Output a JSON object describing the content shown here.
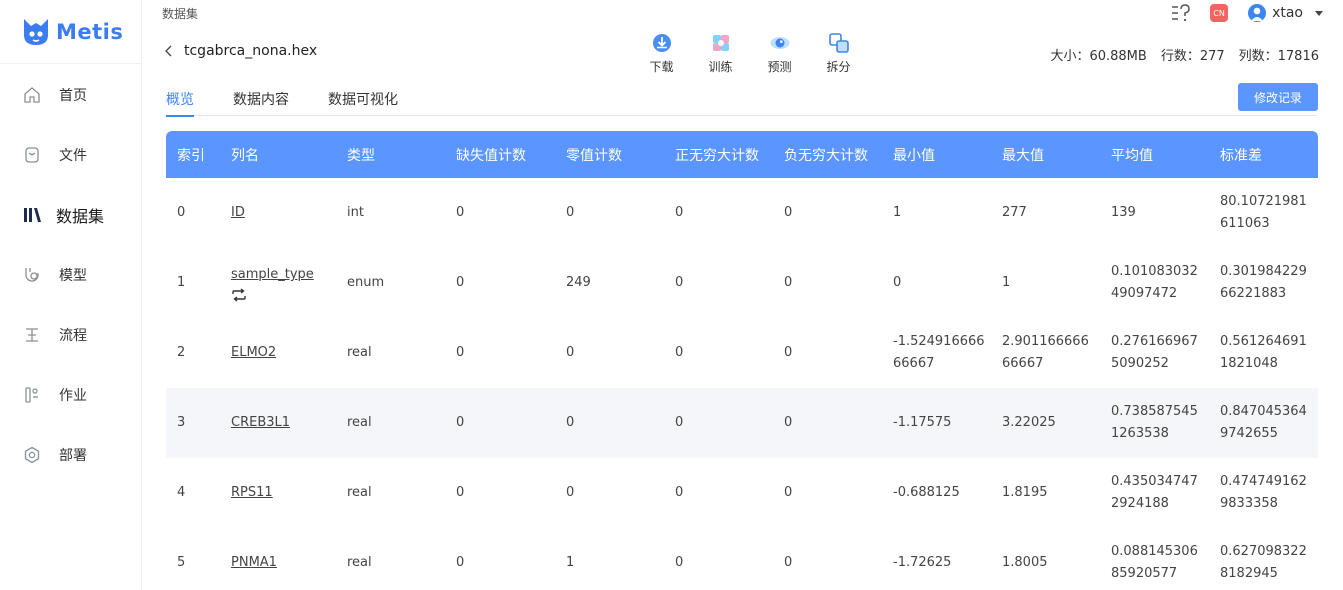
{
  "brand": {
    "name": "Metis",
    "color": "#3b7cf0"
  },
  "sidebar": {
    "items": [
      {
        "label": "首页",
        "icon": "home-icon"
      },
      {
        "label": "文件",
        "icon": "file-icon"
      },
      {
        "label": "数据集",
        "icon": "dataset-icon",
        "active": true
      },
      {
        "label": "模型",
        "icon": "model-icon"
      },
      {
        "label": "流程",
        "icon": "flow-icon"
      },
      {
        "label": "作业",
        "icon": "job-icon"
      },
      {
        "label": "部署",
        "icon": "deploy-icon"
      }
    ]
  },
  "header": {
    "breadcrumb": "数据集",
    "file_name": "tcgabrca_nona.hex",
    "lang_badge": "CN",
    "user": "xtao",
    "actions": [
      {
        "label": "下载",
        "icon": "download-icon"
      },
      {
        "label": "训练",
        "icon": "train-icon"
      },
      {
        "label": "预测",
        "icon": "predict-icon"
      },
      {
        "label": "拆分",
        "icon": "split-icon"
      }
    ],
    "stats": {
      "size": "大小：60.88MB",
      "rows": "行数：277",
      "cols": "列数：17816"
    }
  },
  "tabs": [
    {
      "label": "概览",
      "active": true
    },
    {
      "label": "数据内容"
    },
    {
      "label": "数据可视化"
    }
  ],
  "edit_button": "修改记录",
  "table": {
    "headers": [
      "索引",
      "列名",
      "类型",
      "缺失值计数",
      "零值计数",
      "正无穷大计数",
      "负无穷大计数",
      "最小值",
      "最大值",
      "平均值",
      "标准差"
    ],
    "rows": [
      [
        "0",
        "ID",
        "int",
        "0",
        "0",
        "0",
        "0",
        "1",
        "277",
        "139",
        "80.10721981611063"
      ],
      [
        "1",
        "sample_type",
        "enum",
        "0",
        "249",
        "0",
        "0",
        "0",
        "1",
        "0.10108303249097472",
        "0.30198422966221883"
      ],
      [
        "2",
        "ELMO2",
        "real",
        "0",
        "0",
        "0",
        "0",
        "-1.52491666666667",
        "2.90116666666667",
        "0.2761669675090252",
        "0.5612646911821048"
      ],
      [
        "3",
        "CREB3L1",
        "real",
        "0",
        "0",
        "0",
        "0",
        "-1.17575",
        "3.22025",
        "0.7385875451263538",
        "0.8470453649742655"
      ],
      [
        "4",
        "RPS11",
        "real",
        "0",
        "0",
        "0",
        "0",
        "-0.688125",
        "1.8195",
        "0.4350347472924188",
        "0.4747491629833358"
      ],
      [
        "5",
        "PNMA1",
        "real",
        "0",
        "1",
        "0",
        "0",
        "-1.72625",
        "1.8005",
        "0.08814530685920577",
        "0.6270983228182945"
      ]
    ]
  },
  "colors": {
    "accent": "#5b95ff",
    "badge": "#f2645f"
  }
}
